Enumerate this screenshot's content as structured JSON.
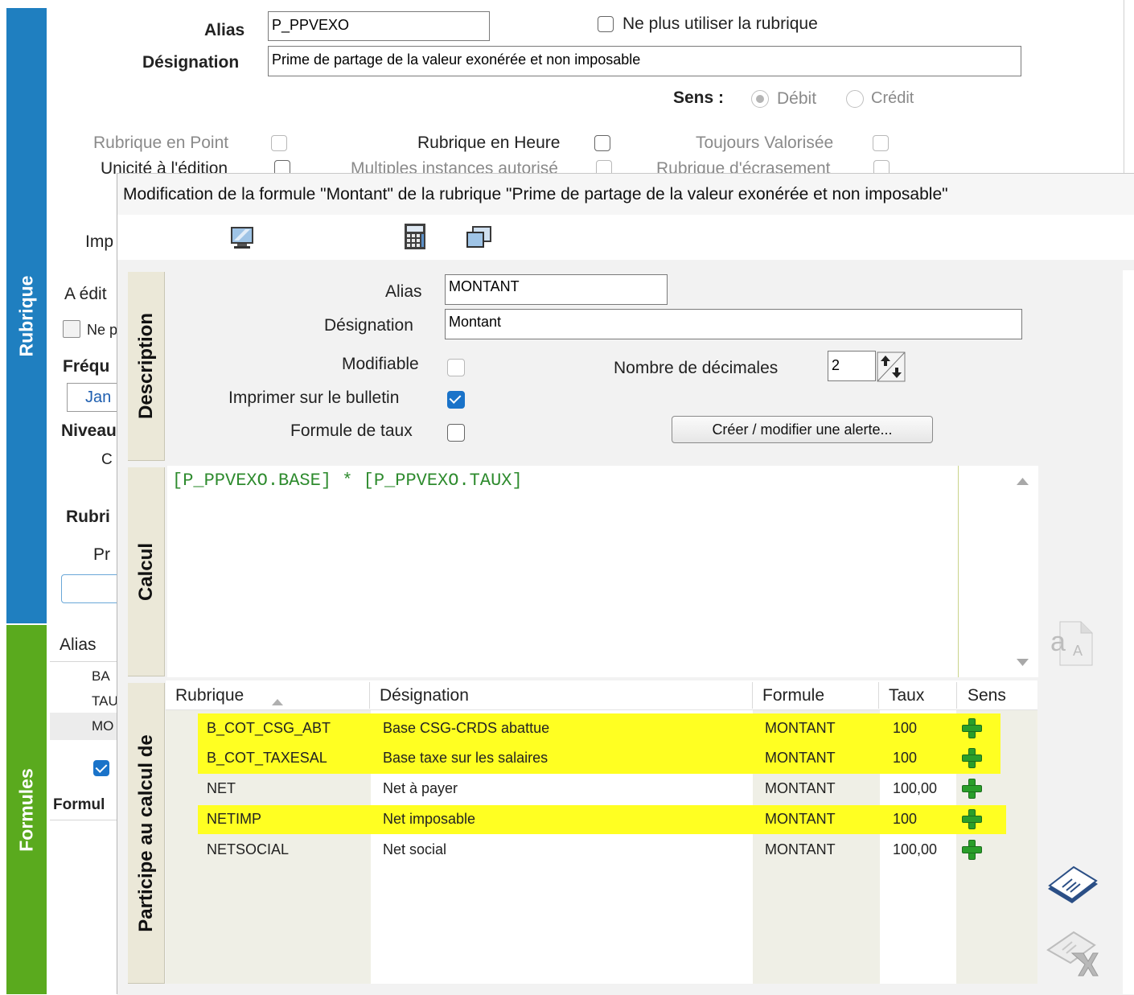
{
  "sidebar": {
    "tab_rubrique": "Rubrique",
    "tab_formules": "Formules",
    "rubrique_color": "#1f7fc0",
    "formules_color": "#5aaa1e"
  },
  "rubrique": {
    "alias_label": "Alias",
    "alias_value": "P_PPVEXO",
    "ne_plus_utiliser_label": "Ne plus utiliser la rubrique",
    "designation_label": "Désignation",
    "designation_value": "Prime de partage de la valeur exonérée et non imposable",
    "sens_label": "Sens :",
    "sens_debit": "Débit",
    "sens_credit": "Crédit",
    "rubrique_en_point": "Rubrique en Point",
    "rubrique_en_heure": "Rubrique en Heure",
    "toujours_valorisee": "Toujours Valorisée",
    "unicite_edition": "Unicité à l'édition",
    "multiples_instances": "Multiples instances autorisé",
    "rubrique_ecrasement": "Rubrique d'écrasement",
    "partial_imp": "Imp",
    "partial_a_edit": "A édit",
    "partial_ne": "Ne p",
    "partial_frequ": "Fréqu",
    "partial_jan": "Jan",
    "partial_niveau": "Niveau",
    "partial_c": "C",
    "partial_rubri": "Rubri",
    "partial_pr": "Pr"
  },
  "formules_panel": {
    "col_alias": "Alias",
    "rows": [
      "BA",
      "TAU",
      "MO"
    ],
    "formul_label": "Formul"
  },
  "dialog": {
    "title": "Modification de la formule \"Montant\" de la rubrique \"Prime de partage de la valeur exonérée et non imposable\"",
    "tabs": {
      "description": "Description",
      "calcul": "Calcul",
      "participe": "Participe au calcul de"
    },
    "description": {
      "alias_label": "Alias",
      "alias_value": "MONTANT",
      "designation_label": "Désignation",
      "designation_value": "Montant",
      "modifiable_label": "Modifiable",
      "imprimer_label": "Imprimer sur le bulletin",
      "formule_taux_label": "Formule de taux",
      "nb_decimales_label": "Nombre de décimales",
      "nb_decimales_value": "2",
      "alerte_button": "Créer / modifier une alerte..."
    },
    "calcul": {
      "formula": "[P_PPVEXO.BASE] * [P_PPVEXO.TAUX]"
    },
    "table": {
      "headers": [
        "Rubrique",
        "Désignation",
        "Formule",
        "Taux",
        "Sens"
      ],
      "rows": [
        {
          "rubrique": "B_COT_CSG_ABT",
          "designation": "Base CSG-CRDS abattue",
          "formule": "MONTANT",
          "taux": "100",
          "highlight": true
        },
        {
          "rubrique": "B_COT_TAXESAL",
          "designation": "Base taxe sur les salaires",
          "formule": "MONTANT",
          "taux": "100",
          "highlight": true
        },
        {
          "rubrique": "NET",
          "designation": "Net à payer",
          "formule": "MONTANT",
          "taux": "100,00",
          "highlight": false
        },
        {
          "rubrique": "NETIMP",
          "designation": "Net imposable",
          "formule": "MONTANT",
          "taux": "100",
          "highlight": true
        },
        {
          "rubrique": "NETSOCIAL",
          "designation": "Net social",
          "formule": "MONTANT",
          "taux": "100,00",
          "highlight": false
        }
      ],
      "highlight_color": "#ffff22"
    }
  }
}
